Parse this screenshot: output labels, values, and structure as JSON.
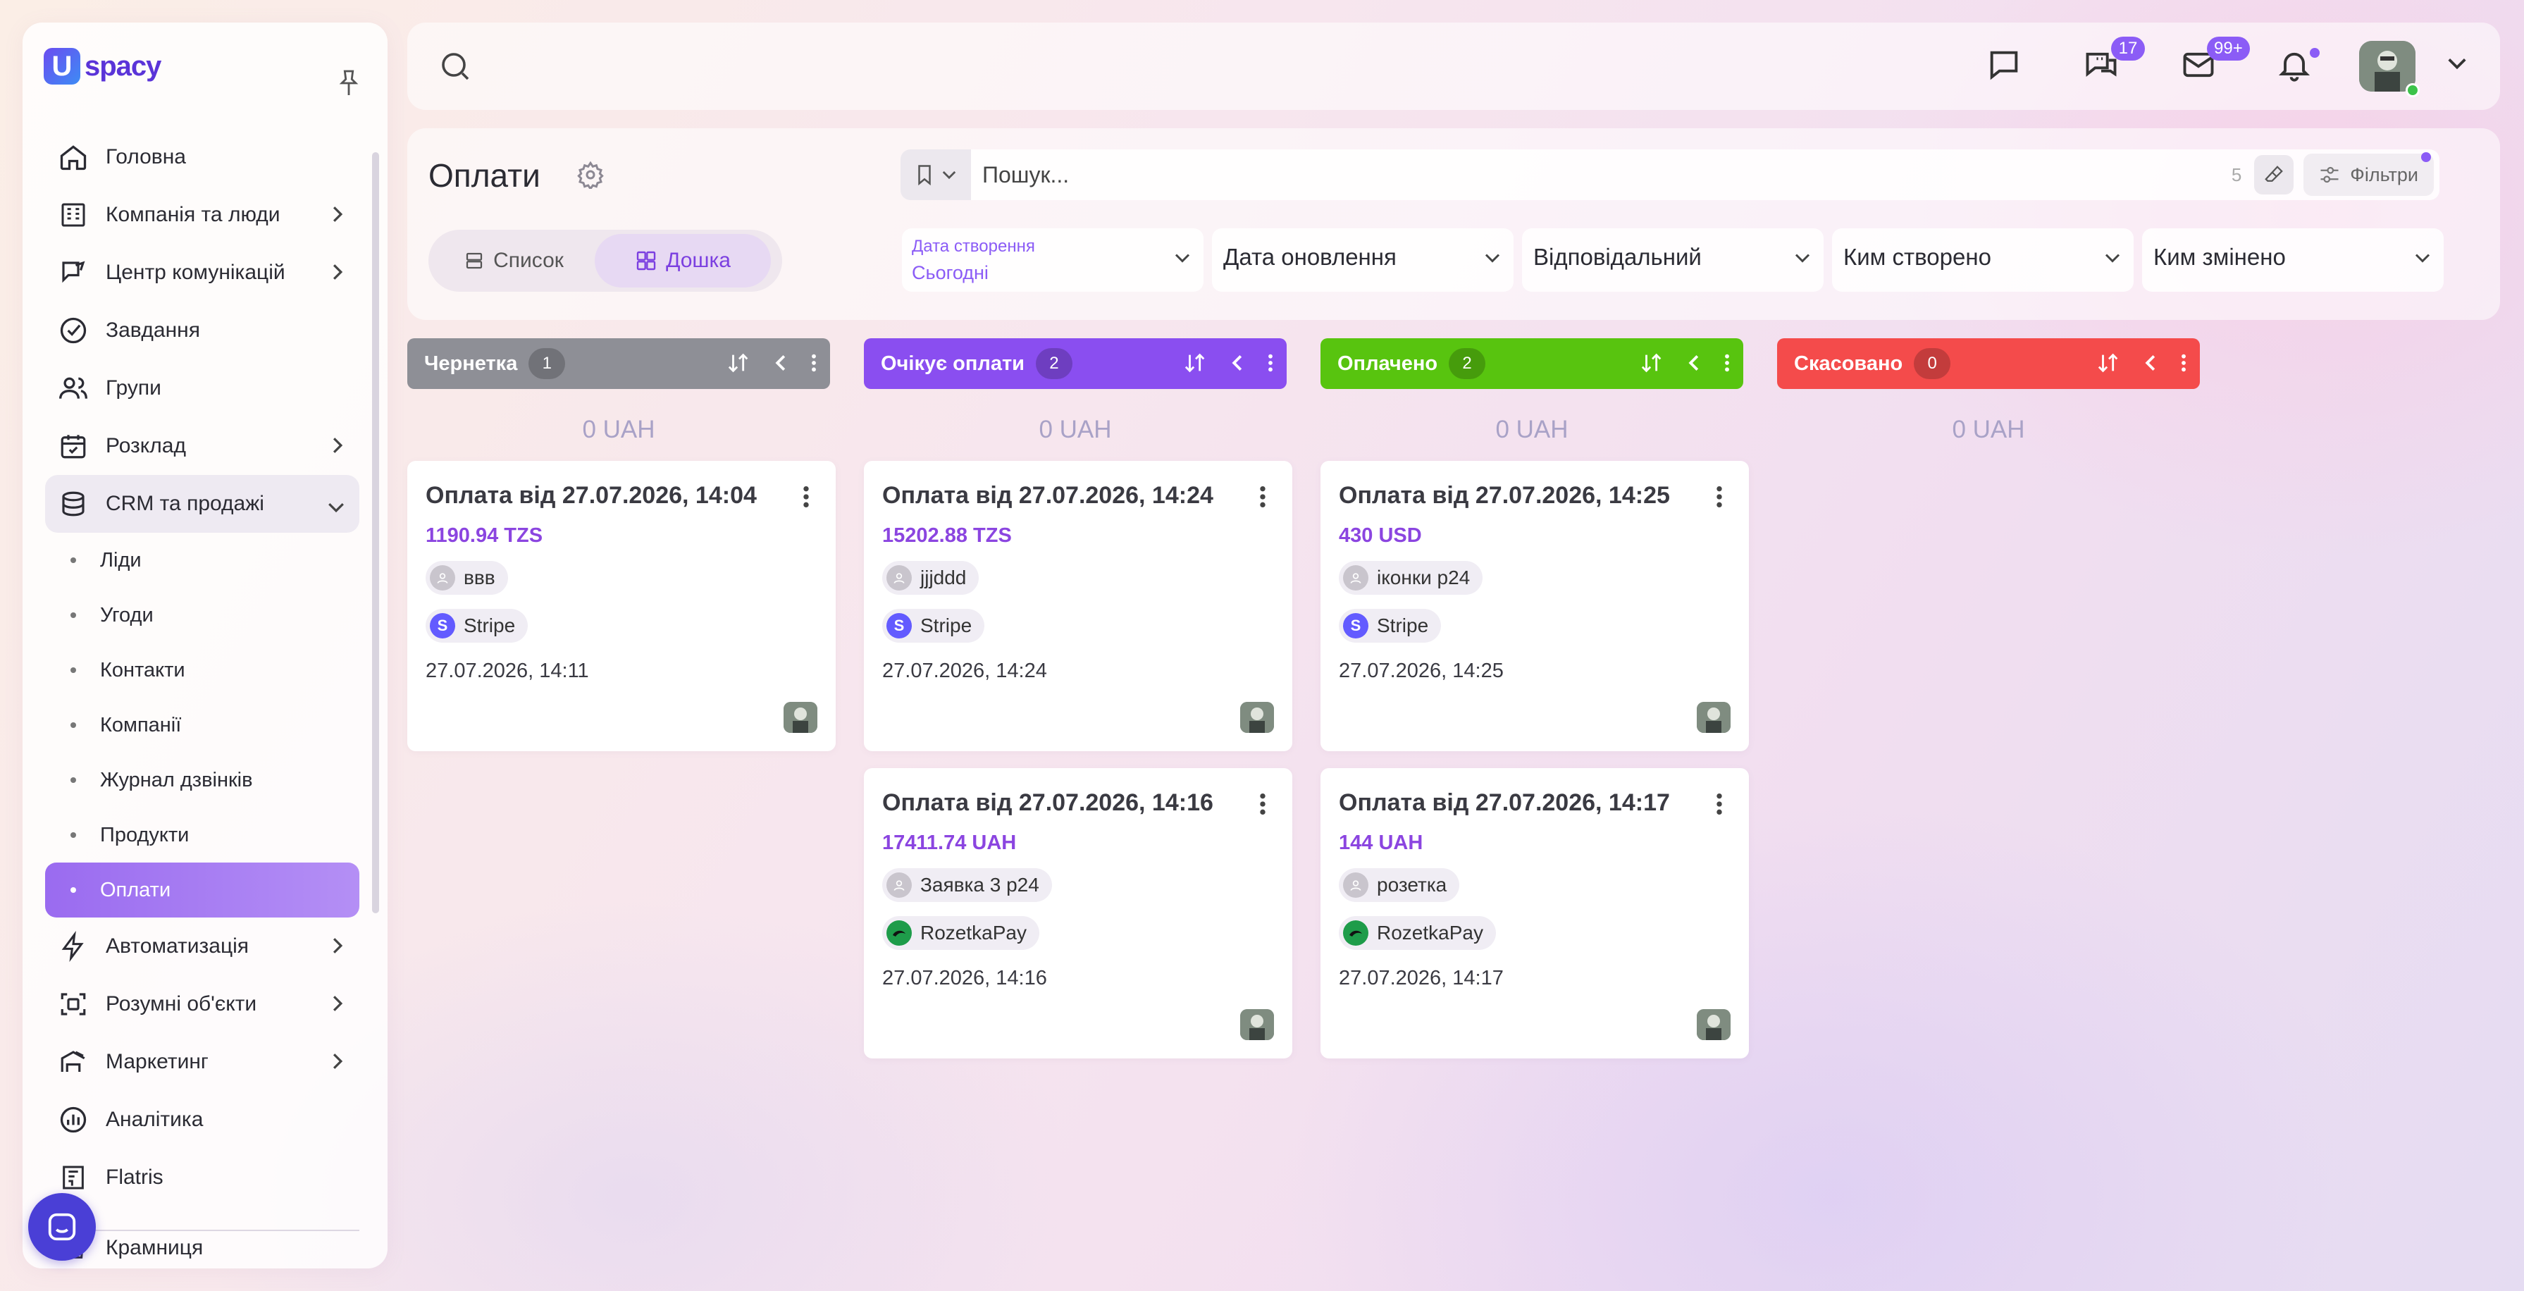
{
  "app": {
    "logo_letter": "U",
    "logo_text": "spacy"
  },
  "sidebar": {
    "items": [
      {
        "label": "Головна",
        "icon": "home-icon"
      },
      {
        "label": "Компанія та люди",
        "icon": "company-icon",
        "has_children": true
      },
      {
        "label": "Центр комунікацій",
        "icon": "communication-icon",
        "has_children": true
      },
      {
        "label": "Завдання",
        "icon": "check-circle-icon"
      },
      {
        "label": "Групи",
        "icon": "users-icon"
      },
      {
        "label": "Розклад",
        "icon": "calendar-icon",
        "has_children": true
      },
      {
        "label": "CRM та продажі",
        "icon": "database-icon",
        "expanded": true
      }
    ],
    "crm_sub": [
      {
        "label": "Ліди"
      },
      {
        "label": "Угоди"
      },
      {
        "label": "Контакти"
      },
      {
        "label": "Компанії"
      },
      {
        "label": "Журнал дзвінків"
      },
      {
        "label": "Продукти"
      },
      {
        "label": "Оплати",
        "active": true
      }
    ],
    "items_after": [
      {
        "label": "Автоматизація",
        "icon": "lightning-icon",
        "has_children": true
      },
      {
        "label": "Розумні об'єкти",
        "icon": "scan-icon",
        "has_children": true
      },
      {
        "label": "Маркетинг",
        "icon": "marketing-icon",
        "has_children": true
      },
      {
        "label": "Аналітика",
        "icon": "analytics-icon"
      },
      {
        "label": "Flatris",
        "icon": "flatris-icon"
      },
      {
        "label": "Крамниця",
        "icon": "shop-icon"
      }
    ]
  },
  "topbar": {
    "chat_badge": "17",
    "mail_badge": "99+"
  },
  "header": {
    "title": "Оплати",
    "views": {
      "list": "Список",
      "board": "Дошка",
      "active": "board"
    },
    "search": {
      "placeholder": "Пошук...",
      "count": "5"
    },
    "filters_label": "Фільтри",
    "filters": [
      {
        "label": "Дата створення",
        "value": "Сьогодні"
      },
      {
        "label": "Дата оновлення"
      },
      {
        "label": "Відповідальний"
      },
      {
        "label": "Ким створено"
      },
      {
        "label": "Ким змінено"
      }
    ]
  },
  "board": {
    "columns": [
      {
        "name": "Чернетка",
        "count": "1",
        "color": "#8e8f96",
        "total": "0 UAH",
        "cards": [
          {
            "title": "Оплата від 27.07.2026, 14:04",
            "amount": "1190.94 TZS",
            "contact": "ввв",
            "gateway": "Stripe",
            "gateway_icon": "stripe-icon",
            "date": "27.07.2026, 14:11"
          }
        ]
      },
      {
        "name": "Очікує оплати",
        "count": "2",
        "color": "#8a4ef0",
        "total": "0 UAH",
        "cards": [
          {
            "title": "Оплата від 27.07.2026, 14:24",
            "amount": "15202.88 TZS",
            "contact": "jjjddd",
            "gateway": "Stripe",
            "gateway_icon": "stripe-icon",
            "date": "27.07.2026, 14:24"
          },
          {
            "title": "Оплата від 27.07.2026, 14:16",
            "amount": "17411.74 UAH",
            "contact": "Заявка 3 p24",
            "gateway": "RozetkaPay",
            "gateway_icon": "rozetkapay-icon",
            "date": "27.07.2026, 14:16"
          }
        ]
      },
      {
        "name": "Оплачено",
        "count": "2",
        "color": "#58c40f",
        "total": "0 UAH",
        "cards": [
          {
            "title": "Оплата від 27.07.2026, 14:25",
            "amount": "430 USD",
            "contact": "іконки p24",
            "gateway": "Stripe",
            "gateway_icon": "stripe-icon",
            "date": "27.07.2026, 14:25"
          },
          {
            "title": "Оплата від 27.07.2026, 14:17",
            "amount": "144 UAH",
            "contact": "розетка",
            "gateway": "RozetkaPay",
            "gateway_icon": "rozetkapay-icon",
            "date": "27.07.2026, 14:17"
          }
        ]
      },
      {
        "name": "Скасовано",
        "count": "0",
        "color": "#f44b4b",
        "total": "0 UAH",
        "cards": []
      }
    ]
  },
  "colors": {
    "accent": "#8b5cf6",
    "amount": "#8b45e0",
    "total": "#a9a2c7"
  }
}
